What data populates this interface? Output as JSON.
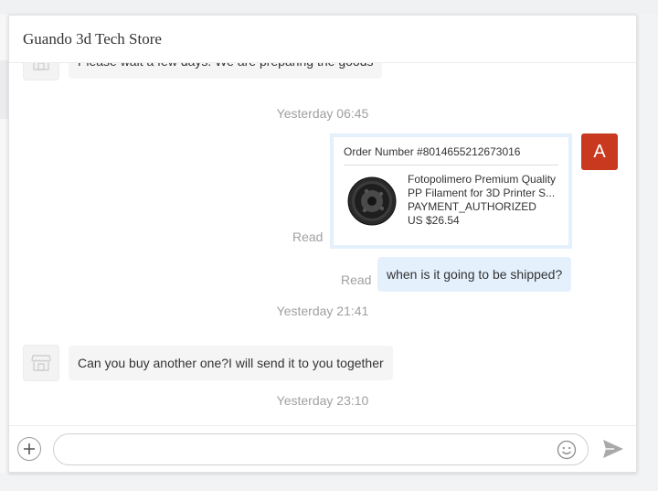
{
  "header": {
    "title": "Guando 3d Tech Store"
  },
  "messages": {
    "first_incoming": "Please wait a few days. We are preparing the goods",
    "timestamp_1": "Yesterday 06:45",
    "order_card": {
      "order_number": "Order Number #8014655212673016",
      "product_title": "Fotopolimero Premium Quality PP Filament for 3D Printer S...",
      "status": "PAYMENT_AUTHORIZED",
      "price": "US $26.54",
      "read_label": "Read"
    },
    "user_avatar_letter": "A",
    "outgoing_message": {
      "text": "when is it going to be shipped?",
      "read_label": "Read"
    },
    "timestamp_2": "Yesterday 21:41",
    "second_incoming": "Can you buy another one?I will send it to you together",
    "timestamp_3": "Yesterday 23:10"
  },
  "input_bar": {
    "placeholder": ""
  },
  "icons": {
    "add": "plus-icon",
    "emoji": "smiley-icon",
    "send": "paper-plane-icon",
    "store": "storefront-icon",
    "product": "filament-spool-image"
  },
  "colors": {
    "outgoing_bubble": "#e4f0fc",
    "incoming_bubble": "#f5f5f5",
    "user_avatar": "#c8391f",
    "timestamp_text": "#a0a0a0"
  }
}
